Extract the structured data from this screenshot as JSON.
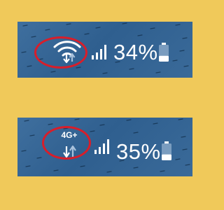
{
  "colors": {
    "frame_background": "#f0c95a",
    "panel_blue": "#3a6a99",
    "icon_white": "#ffffff",
    "icon_dim": "#a9c2dc",
    "highlight_red": "#d81e2a"
  },
  "panels": [
    {
      "network_icon": "wifi-icon",
      "signal_icon": "signal-bars-icon",
      "battery_percent": "34%",
      "battery_level": 0.34,
      "battery_icon": "battery-icon"
    },
    {
      "network_icon": "mobile-data-icon",
      "network_label": "4G+",
      "signal_icon": "signal-bars-icon",
      "battery_percent": "35%",
      "battery_level": 0.35,
      "battery_icon": "battery-icon"
    }
  ]
}
